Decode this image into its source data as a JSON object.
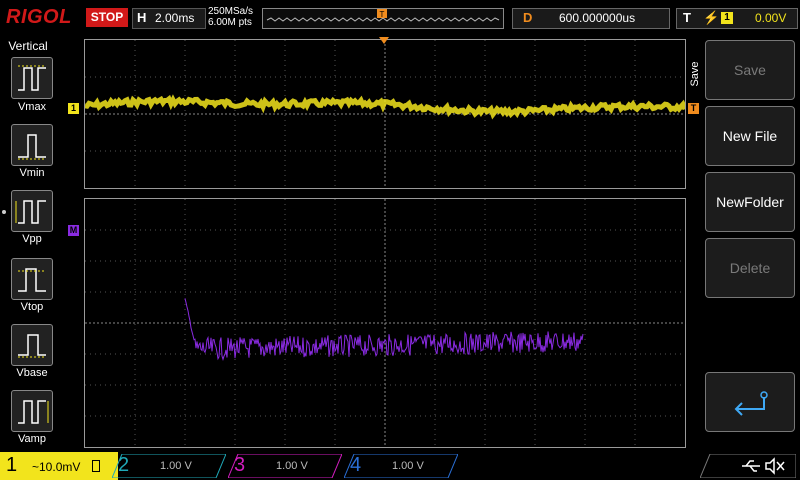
{
  "header": {
    "logo": "RIGOL",
    "run_state": "STOP",
    "timebase_label": "H",
    "timebase_value": "2.00ms",
    "sample_rate": "250MSa/s",
    "memory_depth": "6.00M pts",
    "trigger_marker": "T",
    "delay_label": "D",
    "delay_value": "600.000000us",
    "trigger_label": "T",
    "trigger_source": "1",
    "trigger_level": "0.00V"
  },
  "left_panel": {
    "title": "Vertical",
    "items": [
      {
        "label": "Vmax",
        "icon": "vmax-icon"
      },
      {
        "label": "Vmin",
        "icon": "vmin-icon"
      },
      {
        "label": "Vpp",
        "icon": "vpp-icon"
      },
      {
        "label": "Vtop",
        "icon": "vtop-icon"
      },
      {
        "label": "Vbase",
        "icon": "vbase-icon"
      },
      {
        "label": "Vamp",
        "icon": "vamp-icon"
      }
    ]
  },
  "waveform": {
    "ch1_marker": "1",
    "math_marker": "M",
    "right_trigger_marker": "T"
  },
  "right_panel": {
    "tab_label": "Save",
    "buttons": [
      {
        "label": "Save",
        "enabled": false
      },
      {
        "label": "New File",
        "enabled": true
      },
      {
        "label": "NewFolder",
        "enabled": true
      },
      {
        "label": "Delete",
        "enabled": false
      }
    ],
    "back_icon": "return-arrow-icon"
  },
  "footer": {
    "ch1": {
      "num": "1",
      "scale": "~10.0mV",
      "color": "#f2e41c"
    },
    "ch2": {
      "num": "2",
      "scale": "1.00 V",
      "color": "#1fa9b8"
    },
    "ch3": {
      "num": "3",
      "scale": "1.00 V",
      "color": "#d21dbf"
    },
    "ch4": {
      "num": "4",
      "scale": "1.00 V",
      "color": "#2a6fd6"
    },
    "usb_icon": "usb-icon",
    "sound_icon": "mute-icon"
  },
  "colors": {
    "ch1": "#f2e41c",
    "math": "#8a2be2",
    "trigger": "#f08c1e",
    "stop": "#d11919"
  }
}
